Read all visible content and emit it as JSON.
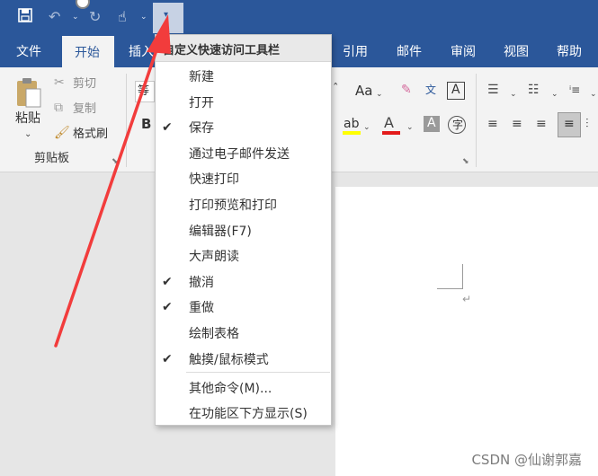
{
  "qat": {
    "save_icon": "save-icon",
    "undo_icon": "undo-icon",
    "redo_icon": "redo-icon",
    "touch_icon": "touch-mode-icon",
    "customize_icon": "chevron-down-icon"
  },
  "tabs": [
    {
      "label": "文件"
    },
    {
      "label": "开始"
    },
    {
      "label": "插入"
    },
    {
      "label": "引用"
    },
    {
      "label": "邮件"
    },
    {
      "label": "审阅"
    },
    {
      "label": "视图"
    },
    {
      "label": "帮助"
    }
  ],
  "ribbon": {
    "paste": "粘贴",
    "cut": "剪切",
    "copy": "复制",
    "format_painter": "格式刷",
    "clipboard_group": "剪贴板",
    "font_box": "等",
    "bold": "B",
    "font_size_label": "Aa"
  },
  "menu": {
    "title": "自定义快速访问工具栏",
    "items": [
      {
        "label": "新建",
        "checked": false
      },
      {
        "label": "打开",
        "checked": false
      },
      {
        "label": "保存",
        "checked": true
      },
      {
        "label": "通过电子邮件发送",
        "checked": false
      },
      {
        "label": "快速打印",
        "checked": false
      },
      {
        "label": "打印预览和打印",
        "checked": false
      },
      {
        "label": "编辑器(F7)",
        "checked": false
      },
      {
        "label": "大声朗读",
        "checked": false
      },
      {
        "label": "撤消",
        "checked": true
      },
      {
        "label": "重做",
        "checked": true
      },
      {
        "label": "绘制表格",
        "checked": false
      },
      {
        "label": "触摸/鼠标模式",
        "checked": true
      }
    ],
    "more_commands": "其他命令(M)...",
    "show_below": "在功能区下方显示(S)"
  },
  "watermark": "CSDN @仙谢郭嘉",
  "colors": {
    "brand": "#2b579a",
    "annotation_arrow": "#f23c3c"
  }
}
